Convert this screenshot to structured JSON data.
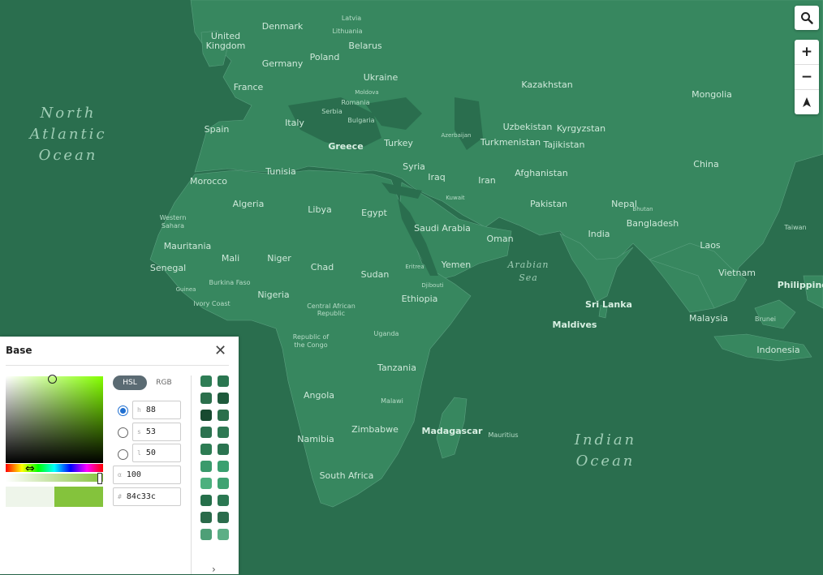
{
  "map": {
    "countries": [
      "Denmark",
      "Latvia",
      "Lithuania",
      "United Kingdom",
      "Belarus",
      "Poland",
      "Germany",
      "Ukraine",
      "France",
      "Moldova",
      "Romania",
      "Serbia",
      "Bulgaria",
      "Italy",
      "Spain",
      "Greece",
      "Turkey",
      "Kazakhstan",
      "Mongolia",
      "Uzbekistan",
      "Kyrgyzstan",
      "Turkmenistan",
      "Tajikistan",
      "Azerbaijan",
      "Tunisia",
      "Morocco",
      "Algeria",
      "Libya",
      "Egypt",
      "Syria",
      "Iraq",
      "Iran",
      "Kuwait",
      "Afghanistan",
      "China",
      "Pakistan",
      "Nepal",
      "Bhutan",
      "Saudi Arabia",
      "Oman",
      "Bangladesh",
      "India",
      "Taiwan",
      "Western Sahara",
      "Mauritania",
      "Mali",
      "Niger",
      "Chad",
      "Sudan",
      "Eritrea",
      "Yemen",
      "Laos",
      "Vietnam",
      "Philippines",
      "Senegal",
      "Guinea",
      "Burkina Faso",
      "Ivory Coast",
      "Nigeria",
      "Central African Republic",
      "Djibouti",
      "Ethiopia",
      "Sri Lanka",
      "Maldives",
      "Malaysia",
      "Brunei",
      "Republic of the Congo",
      "Uganda",
      "Indonesia",
      "Tanzania",
      "Angola",
      "Malawi",
      "Zimbabwe",
      "Namibia",
      "Madagascar",
      "Mauritius",
      "South Africa"
    ],
    "oceans": {
      "north_atlantic": [
        "North",
        "Atlantic",
        "Ocean"
      ],
      "indian": [
        "Indian",
        "Ocean"
      ],
      "arabian_sea": [
        "Arabian",
        "Sea"
      ]
    }
  },
  "controls": {
    "search_icon": "search-icon",
    "zoom_in": "+",
    "zoom_out": "−",
    "compass": "⮝"
  },
  "panel": {
    "title": "Base",
    "close": "✕",
    "tabs": [
      "HSL",
      "RGB"
    ],
    "active_tab": "HSL",
    "h_label": "h",
    "h_value": "88",
    "s_label": "s",
    "s_value": "53",
    "l_label": "l",
    "l_value": "50",
    "a_label": "α",
    "a_value": "100",
    "hex_label": "#",
    "hex_value": "84c33c",
    "selected_channel": "h",
    "color": "#84c33c",
    "swatches": [
      "#2e7d55",
      "#2a7650",
      "#2b6f4c",
      "#1f5a3c",
      "#174a30",
      "#2a6f4b",
      "#2c7350",
      "#2e7953",
      "#2d7c53",
      "#2b7450",
      "#3a9a6c",
      "#3aa070",
      "#4cb07e",
      "#3fa372",
      "#256f4a",
      "#2b7852",
      "#2a6a4a",
      "#2b6c4c",
      "#4e9f77",
      "#5caf86"
    ],
    "chevron": "›"
  }
}
